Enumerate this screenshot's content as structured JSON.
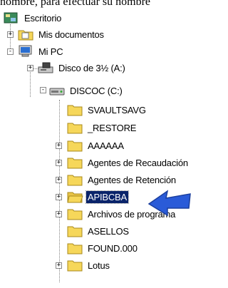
{
  "caption": "nombre, para efectuar su nombre",
  "tree": {
    "desktop": "Escritorio",
    "my_documents": "Mis documentos",
    "my_pc": "Mi PC",
    "floppy": "Disco de 3½ (A:)",
    "drive_c": "DISCOC (C:)",
    "folders": [
      {
        "label": "SVAULTSAVG",
        "expandable": false
      },
      {
        "label": "_RESTORE",
        "expandable": false
      },
      {
        "label": "AAAAAA",
        "expandable": true
      },
      {
        "label": "Agentes de Recaudación",
        "expandable": true
      },
      {
        "label": "Agentes de Retención",
        "expandable": true
      },
      {
        "label": "APIBCBA",
        "expandable": true,
        "selected": true
      },
      {
        "label": "Archivos de programa",
        "expandable": true
      },
      {
        "label": "ASELLOS",
        "expandable": false
      },
      {
        "label": "FOUND.000",
        "expandable": false
      },
      {
        "label": "Lotus",
        "expandable": true
      }
    ]
  },
  "colors": {
    "folder": "#f6d75a",
    "folder_edge": "#a88a1c",
    "selection": "#0a246a",
    "arrow": "#2a5bd8"
  }
}
